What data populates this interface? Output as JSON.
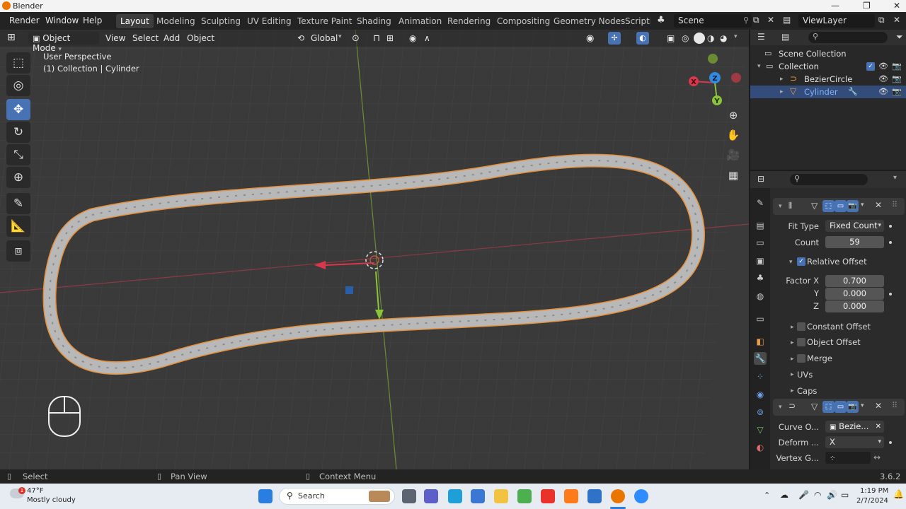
{
  "window": {
    "title": "Blender",
    "minimize": "—",
    "maximize": "❐",
    "close": "✕"
  },
  "menus": [
    "Render",
    "Window",
    "Help"
  ],
  "workspaces": [
    "Layout",
    "Modeling",
    "Sculpting",
    "UV Editing",
    "Texture Paint",
    "Shading",
    "Animation",
    "Rendering",
    "Compositing",
    "Geometry Nodes",
    "Scripti"
  ],
  "scene": {
    "label": "Scene",
    "view_layer": "ViewLayer"
  },
  "viewport_header": {
    "mode": "Object Mode",
    "menu_items": [
      "View",
      "Select",
      "Add",
      "Object"
    ],
    "transform_orientation": "Global"
  },
  "viewport": {
    "perspective": "User Perspective",
    "collection_info": "(1) Collection | Cylinder",
    "gizmo_axes": {
      "x": "X",
      "y": "Y",
      "z": "Z"
    }
  },
  "outliner": {
    "scene_collection": "Scene Collection",
    "collection": "Collection",
    "objects": [
      {
        "name": "BezierCircle",
        "selected": false
      },
      {
        "name": "Cylinder",
        "selected": true
      }
    ]
  },
  "properties": {
    "array_modifier": {
      "fit_type_label": "Fit Type",
      "fit_type_value": "Fixed Count",
      "count_label": "Count",
      "count_value": "59",
      "relative_offset_label": "Relative Offset",
      "factor_x_label": "Factor X",
      "factor_x": "0.700",
      "y_label": "Y",
      "factor_y": "0.000",
      "z_label": "Z",
      "factor_z": "0.000",
      "constant_offset": "Constant Offset",
      "object_offset": "Object Offset",
      "merge": "Merge",
      "uvs": "UVs",
      "caps": "Caps"
    },
    "curve_modifier": {
      "curve_object_label": "Curve O...",
      "curve_object_value": "Bezie...",
      "deform_axis_label": "Deform ...",
      "deform_axis_value": "X",
      "vertex_group_label": "Vertex G..."
    }
  },
  "statusbar": {
    "select": "Select",
    "pan_view": "Pan View",
    "context_menu": "Context Menu",
    "version": "3.6.2"
  },
  "taskbar": {
    "weather_temp": "47°F",
    "weather_desc": "Mostly cloudy",
    "weather_badge": "1",
    "search_placeholder": "Search",
    "time": "1:19 PM",
    "date": "2/7/2024"
  },
  "colors": {
    "accent": "#4772b3",
    "selected_row": "#344c7a",
    "outline_orange": "#e7903a",
    "axis_red": "#c53e4e",
    "axis_green": "#8bc43a",
    "gizmo_blue": "#2f8ce0"
  }
}
